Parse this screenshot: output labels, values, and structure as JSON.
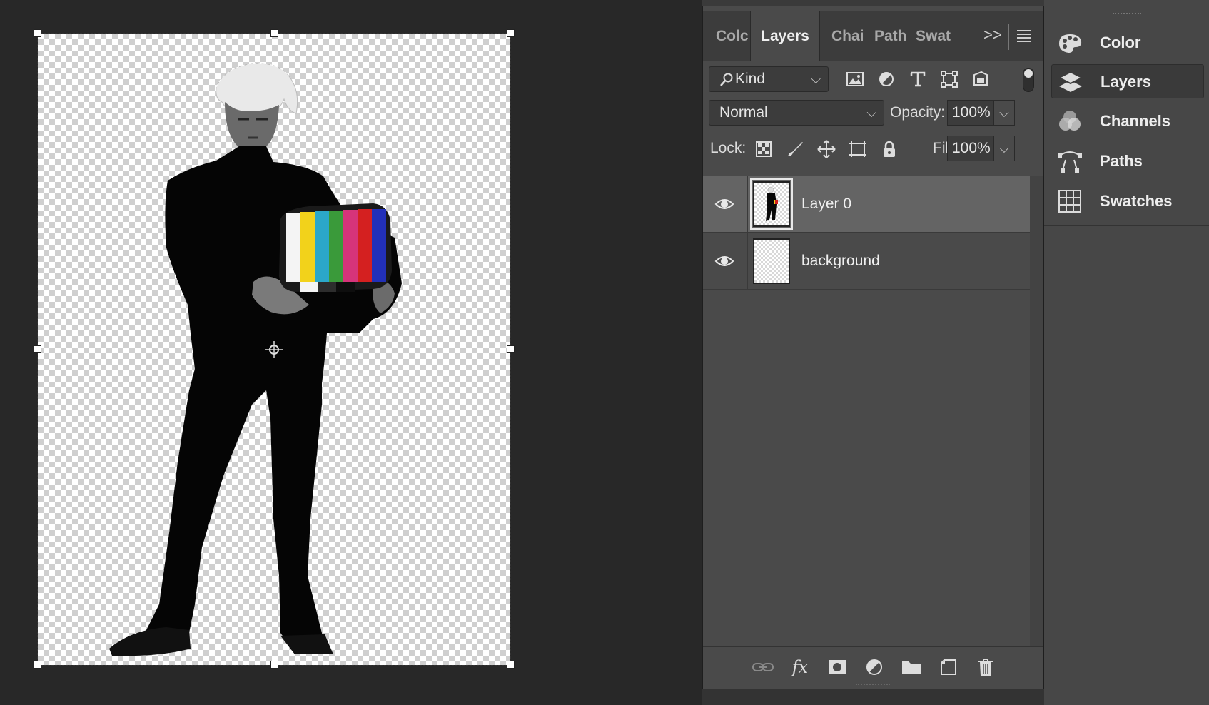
{
  "tabs": [
    {
      "label": "Colc"
    },
    {
      "label": "Layers"
    },
    {
      "label": "Chai"
    },
    {
      "label": "Path"
    },
    {
      "label": "Swat"
    }
  ],
  "tab_overflow": ">>",
  "filter": {
    "icon": "search-icon",
    "kind_label": "Kind"
  },
  "blend": {
    "mode": "Normal",
    "opacity_label": "Opacity:",
    "opacity_value": "100%"
  },
  "lock": {
    "label": "Lock:",
    "fill_label": "Fill:",
    "fill_value": "100%"
  },
  "layers": [
    {
      "name": "Layer 0",
      "selected": true,
      "visible": true
    },
    {
      "name": "background",
      "selected": false,
      "visible": true
    }
  ],
  "dock": [
    {
      "label": "Color",
      "icon": "palette-icon"
    },
    {
      "label": "Layers",
      "icon": "layers-icon",
      "active": true
    },
    {
      "label": "Channels",
      "icon": "channels-icon"
    },
    {
      "label": "Paths",
      "icon": "paths-icon"
    },
    {
      "label": "Swatches",
      "icon": "swatches-icon"
    }
  ],
  "colors": {
    "panel_bg": "#4a4a4a",
    "selected_row": "#646464",
    "canvas_bg": "#282828",
    "tv_bars": [
      "#f4f4f4",
      "#f2d21b",
      "#2ba7c9",
      "#3a9a3a",
      "#d6347a",
      "#d42020",
      "#2230b8"
    ]
  }
}
